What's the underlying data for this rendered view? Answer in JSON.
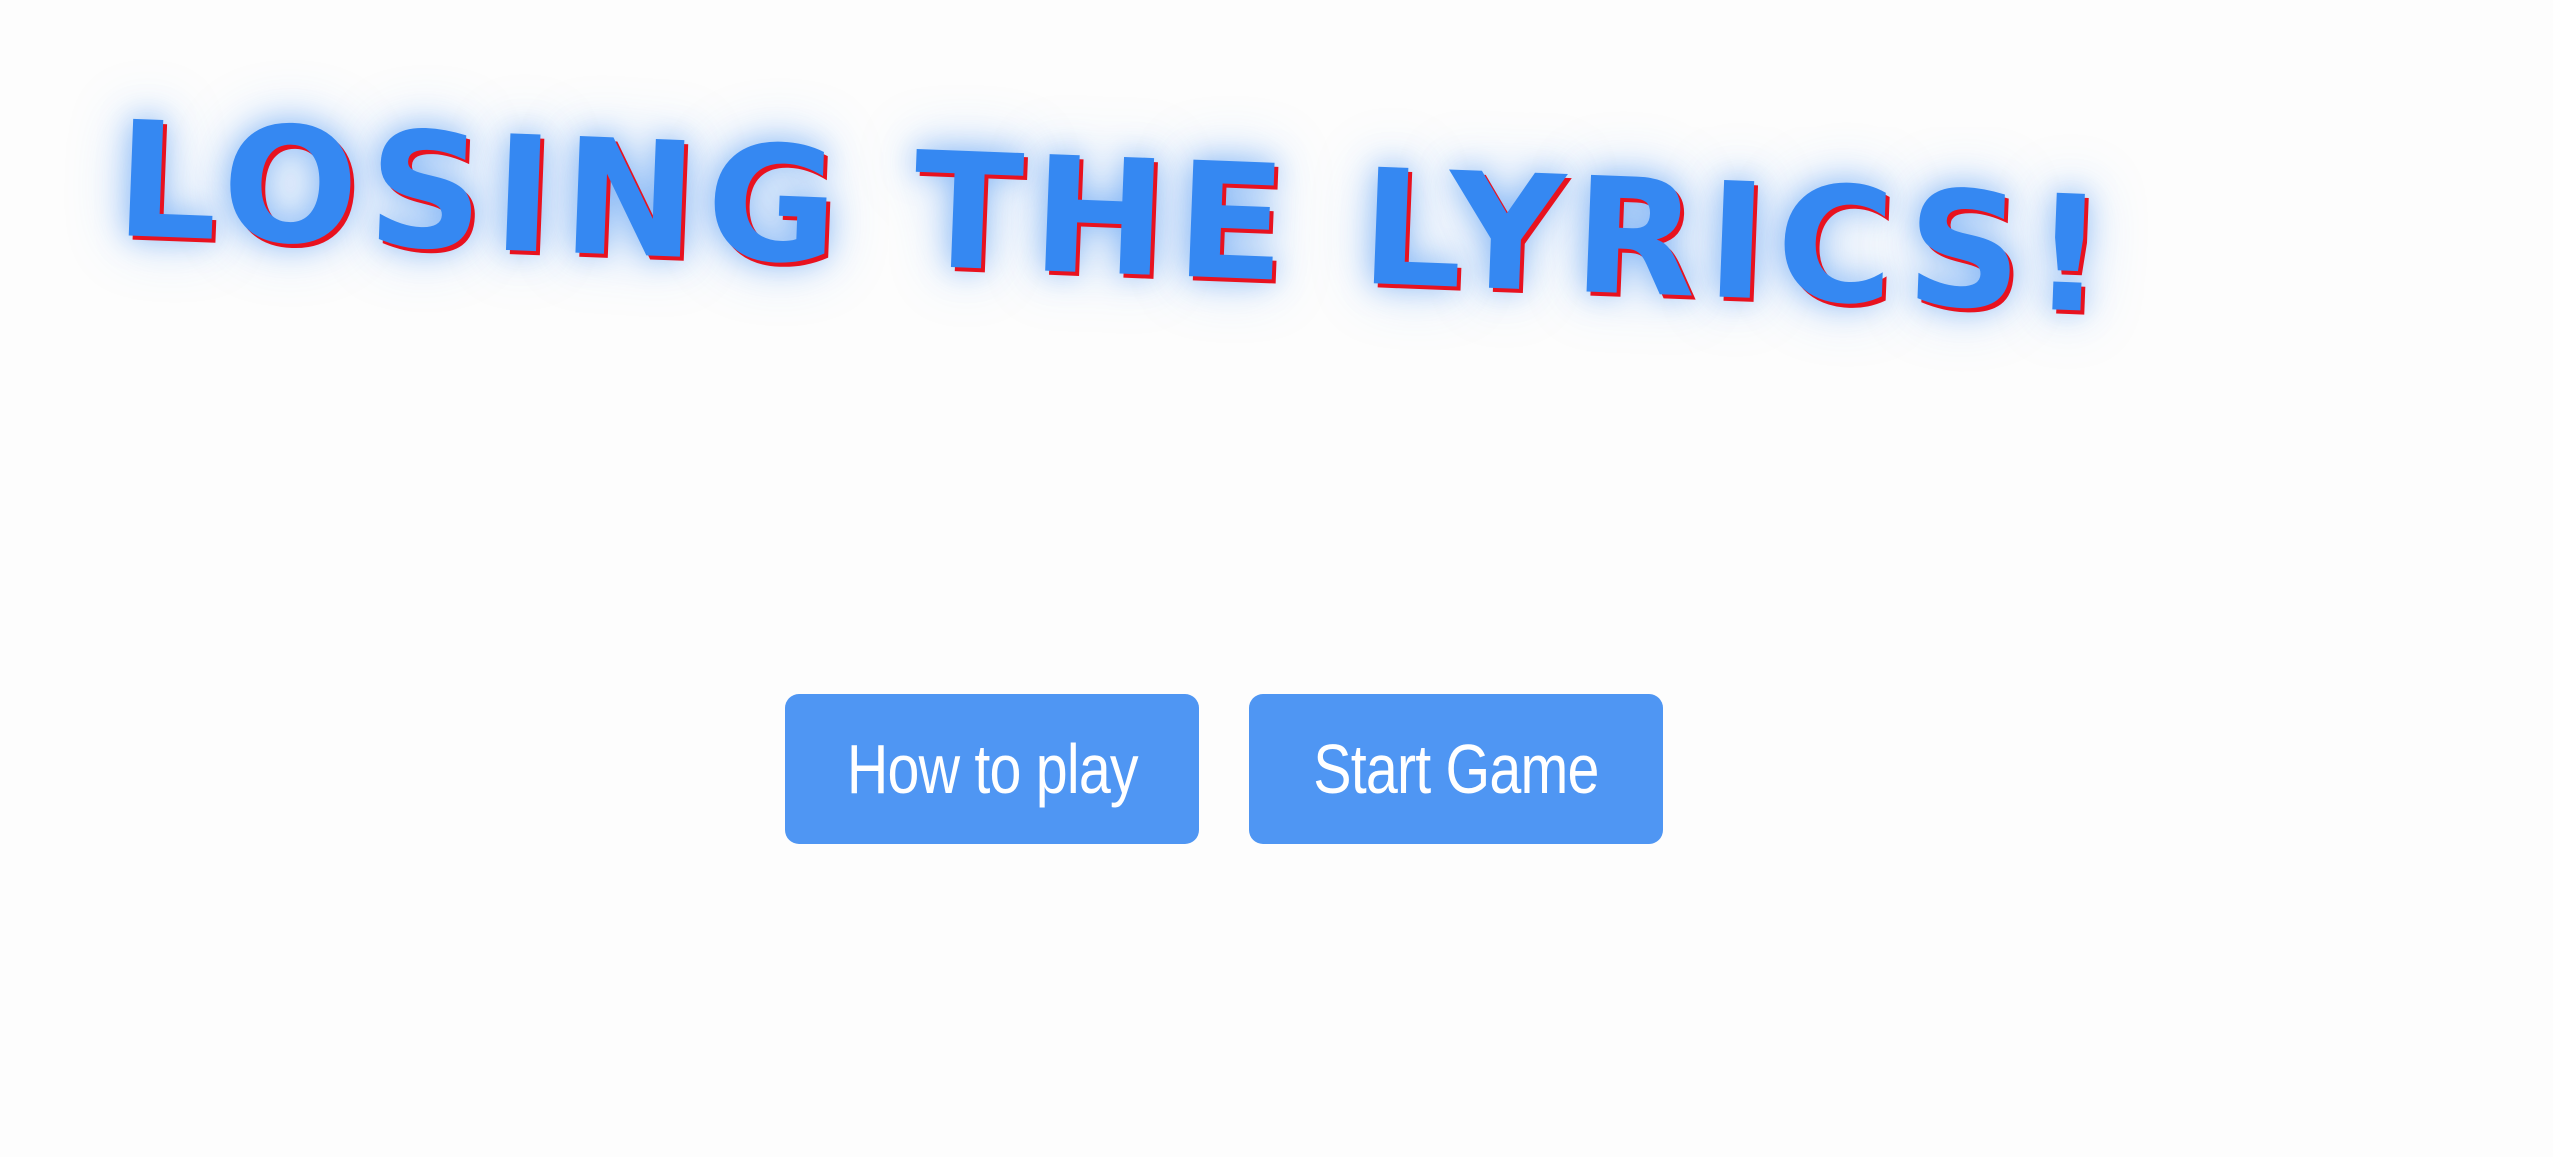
{
  "title": "LOSING THE LYRICS!",
  "buttons": {
    "how_to_play": "How to play",
    "start_game": "Start Game"
  },
  "colors": {
    "title_fill": "#3588f2",
    "title_shadow": "#e8121f",
    "button_bg": "#4f96f3",
    "button_text": "#ffffff",
    "background": "#fdfdfd"
  }
}
